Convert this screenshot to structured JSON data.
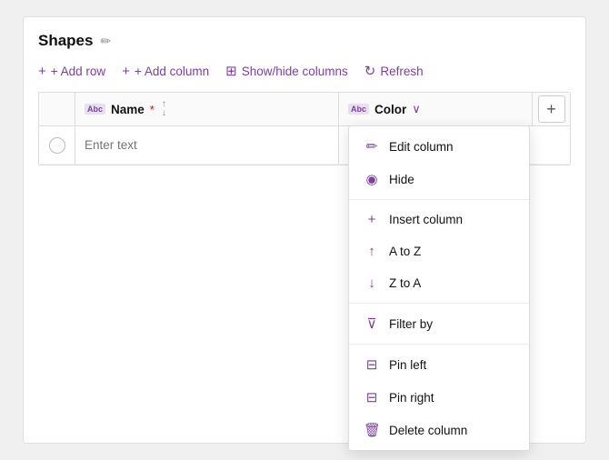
{
  "panel": {
    "title": "Shapes",
    "edit_icon": "✏"
  },
  "toolbar": {
    "add_row": "+ Add row",
    "add_column": "+ Add column",
    "show_hide": "Show/hide columns",
    "refresh": "Refresh"
  },
  "table": {
    "col_name_type": "Abc",
    "col_name_label": "Name",
    "col_name_required": "*",
    "col_color_type": "Abc",
    "col_color_label": "Color",
    "add_col_btn": "+",
    "placeholder": "Enter text"
  },
  "dropdown": {
    "items": [
      {
        "id": "edit-column",
        "icon": "✏",
        "label": "Edit column"
      },
      {
        "id": "hide",
        "icon": "👁",
        "label": "Hide"
      },
      {
        "id": "insert-column",
        "icon": "+",
        "label": "Insert column"
      },
      {
        "id": "a-to-z",
        "icon": "↑",
        "label": "A to Z"
      },
      {
        "id": "z-to-a",
        "icon": "↓",
        "label": "Z to A"
      },
      {
        "id": "filter-by",
        "icon": "▽",
        "label": "Filter by"
      },
      {
        "id": "pin-left",
        "icon": "▣",
        "label": "Pin left"
      },
      {
        "id": "pin-right",
        "icon": "▣",
        "label": "Pin right"
      },
      {
        "id": "delete-column",
        "icon": "🗑",
        "label": "Delete column"
      }
    ]
  }
}
